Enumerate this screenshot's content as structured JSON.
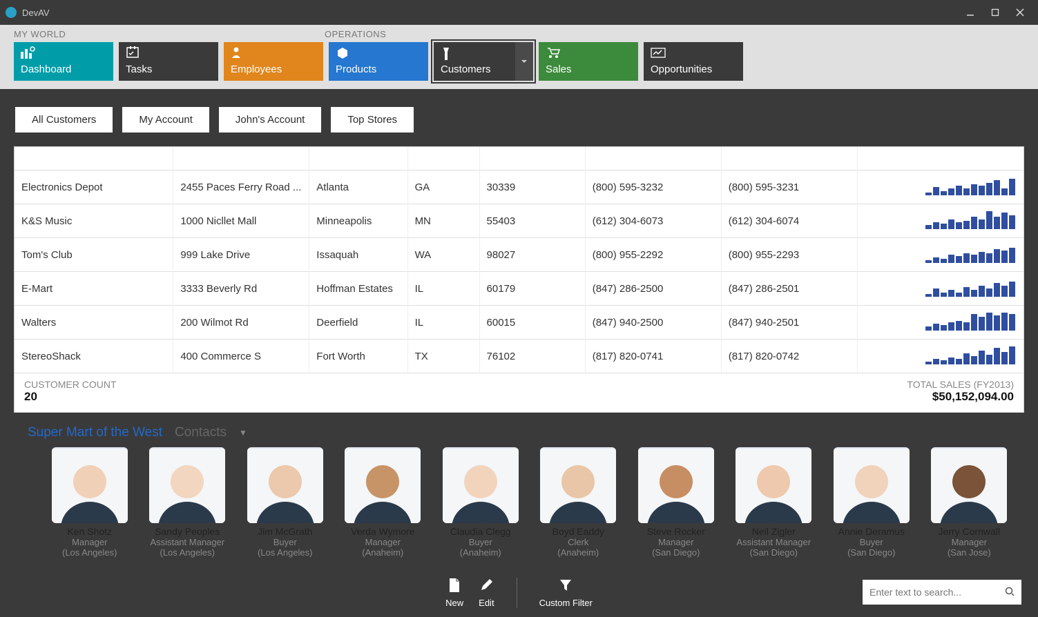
{
  "app": {
    "title": "DevAV"
  },
  "nav": {
    "groups": {
      "g1": "MY WORLD",
      "g2": "OPERATIONS"
    },
    "tiles": {
      "dashboard": "Dashboard",
      "tasks": "Tasks",
      "employees": "Employees",
      "products": "Products",
      "customers": "Customers",
      "sales": "Sales",
      "opportunities": "Opportunities"
    }
  },
  "subnav": {
    "items": [
      "All Customers",
      "My Account",
      "John's Account",
      "Top Stores"
    ]
  },
  "grid": {
    "rows": [
      {
        "name": "Electronics Depot",
        "addr": "2455 Paces Ferry Road ...",
        "city": "Atlanta",
        "state": "GA",
        "zip": "30339",
        "phone": "(800) 595-3232",
        "fax": "(800) 595-3231",
        "spark": [
          4,
          12,
          6,
          10,
          14,
          10,
          16,
          14,
          18,
          22,
          10,
          24
        ]
      },
      {
        "name": "K&S Music",
        "addr": "1000 Nicllet Mall",
        "city": "Minneapolis",
        "state": "MN",
        "zip": "55403",
        "phone": "(612) 304-6073",
        "fax": "(612) 304-6074",
        "spark": [
          6,
          10,
          8,
          14,
          10,
          12,
          18,
          14,
          26,
          18,
          24,
          20
        ]
      },
      {
        "name": "Tom's Club",
        "addr": "999 Lake Drive",
        "city": "Issaquah",
        "state": "WA",
        "zip": "98027",
        "phone": "(800) 955-2292",
        "fax": "(800) 955-2293",
        "spark": [
          4,
          8,
          6,
          12,
          10,
          14,
          12,
          16,
          14,
          20,
          18,
          22
        ]
      },
      {
        "name": "E-Mart",
        "addr": "3333 Beverly Rd",
        "city": "Hoffman Estates",
        "state": "IL",
        "zip": "60179",
        "phone": "(847) 286-2500",
        "fax": "(847) 286-2501",
        "spark": [
          4,
          12,
          6,
          10,
          6,
          14,
          10,
          16,
          12,
          20,
          16,
          22
        ]
      },
      {
        "name": "Walters",
        "addr": "200 Wilmot Rd",
        "city": "Deerfield",
        "state": "IL",
        "zip": "60015",
        "phone": "(847) 940-2500",
        "fax": "(847) 940-2501",
        "spark": [
          6,
          10,
          8,
          12,
          14,
          12,
          24,
          20,
          26,
          22,
          26,
          24
        ]
      },
      {
        "name": "StereoShack",
        "addr": "400 Commerce S",
        "city": "Fort Worth",
        "state": "TX",
        "zip": "76102",
        "phone": "(817) 820-0741",
        "fax": "(817) 820-0742",
        "spark": [
          4,
          8,
          6,
          10,
          8,
          16,
          12,
          20,
          14,
          24,
          18,
          26
        ]
      }
    ],
    "footer": {
      "count_label": "CUSTOMER COUNT",
      "count_value": "20",
      "total_label": "TOTAL SALES (FY2013)",
      "total_value": "$50,152,094.00"
    }
  },
  "detail": {
    "customer": "Super Mart of the West",
    "section": "Contacts"
  },
  "contacts": [
    {
      "name": "Ken Shotz",
      "role": "Manager",
      "loc": "(Los Angeles)"
    },
    {
      "name": "Sandy Peoples",
      "role": "Assistant Manager",
      "loc": "(Los Angeles)"
    },
    {
      "name": "Jim McGrath",
      "role": "Buyer",
      "loc": "(Los Angeles)"
    },
    {
      "name": "Verda Wymore",
      "role": "Manager",
      "loc": "(Anaheim)"
    },
    {
      "name": "Claudia Clegg",
      "role": "Buyer",
      "loc": "(Anaheim)"
    },
    {
      "name": "Boyd Eaddy",
      "role": "Clerk",
      "loc": "(Anaheim)"
    },
    {
      "name": "Steve Rocker",
      "role": "Manager",
      "loc": "(San Diego)"
    },
    {
      "name": "Neil Zigler",
      "role": "Assistant Manager",
      "loc": "(San Diego)"
    },
    {
      "name": "Annie Deramus",
      "role": "Buyer",
      "loc": "(San Diego)"
    },
    {
      "name": "Jerry Cornwall",
      "role": "Manager",
      "loc": "(San Jose)"
    }
  ],
  "bottombar": {
    "new": "New",
    "edit": "Edit",
    "filter": "Custom Filter",
    "search_placeholder": "Enter text to search..."
  }
}
